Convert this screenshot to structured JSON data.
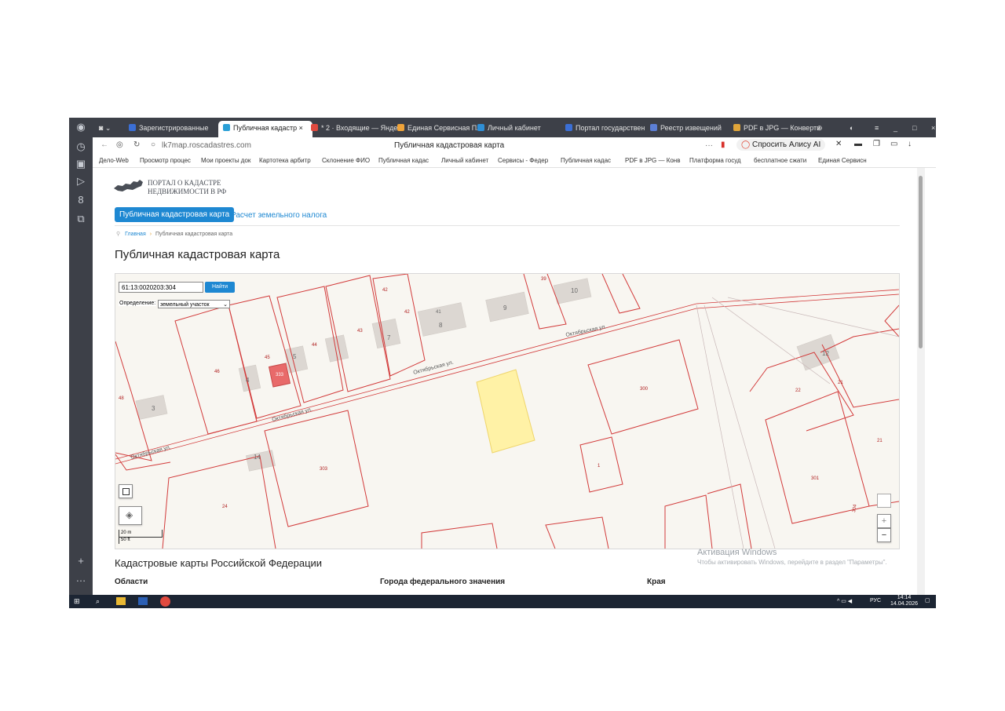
{
  "browser": {
    "tabs": [
      {
        "label": "Зарегистрированные",
        "color": "#3b6fd6"
      },
      {
        "label": "Публичная кадастр",
        "color": "#2a9fd6"
      },
      {
        "label": "* 2 · Входящие — Янде",
        "color": "#e04a3f"
      },
      {
        "label": "Единая Сервисная Пл",
        "color": "#f0a43a"
      },
      {
        "label": "Личный кабинет",
        "color": "#2f8fd6"
      },
      {
        "label": "Портал государствен",
        "color": "#3b6fd6"
      },
      {
        "label": "Реестр извещений",
        "color": "#5c7fd6"
      },
      {
        "label": "PDF в JPG — Конверти",
        "color": "#e0a53a"
      }
    ],
    "address": "lk7map.roscadastres.com",
    "page_title": "Публичная кадастровая карта",
    "alice_label": "Спросить Алису AI",
    "bookmarks": [
      "Дело-Web",
      "Просмотр процес",
      "Мои проекты док",
      "Картотека арбитр",
      "Склонение ФИО",
      "Публичная кадас",
      "Личный кабинет",
      "Сервисы - Федер",
      "Публичная кадас",
      "PDF в JPG — Конв",
      "Платформа госуд",
      "бесплатное сжати",
      "Единая Сервисн"
    ]
  },
  "site": {
    "logo_line1": "ПОРТАЛ О КАДАСТРЕ",
    "logo_line2": "НЕДВИЖИМОСТИ В РФ",
    "nav_active": "Публичная кадастровая карта",
    "nav_other": "Расчет земельного налога",
    "breadcrumb_home": "Главная",
    "breadcrumb_current": "Публичная кадастровая карта",
    "heading": "Публичная кадастровая карта"
  },
  "map": {
    "search_value": "61:13:0020203:304",
    "search_button": "Найти",
    "def_label": "Определение:",
    "def_selected": "земельный участок",
    "scale_m": "20 m",
    "scale_ft": "50 ft",
    "zoom_in": "+",
    "zoom_out": "−",
    "street": "Октябрьская ул.",
    "parcel_labels": [
      "42",
      "39",
      "10",
      "9",
      "8",
      "41",
      "42",
      "7",
      "43",
      "44",
      "45",
      "46",
      "4",
      "5",
      "48",
      "3",
      "300",
      "12",
      "22",
      "21",
      "21",
      "301",
      "1",
      "303",
      "14",
      "24",
      "333",
      "304",
      "304"
    ]
  },
  "below": {
    "heading": "Кадастровые карты Российской Федерации",
    "col1": "Области",
    "col2": "Города федерального значения",
    "col3": "Края"
  },
  "windows": {
    "activation_title": "Активация Windows",
    "activation_text": "Чтобы активировать Windows, перейдите в раздел \"Параметры\".",
    "tray_lang": "РУС",
    "tray_time": "14:14",
    "tray_date": "14.04.2026"
  },
  "colors": {
    "accent": "#1e88d2",
    "parcel_line": "#d23a3a",
    "selected_parcel": "#fff2a6",
    "highlight_building": "#e86a6a"
  }
}
